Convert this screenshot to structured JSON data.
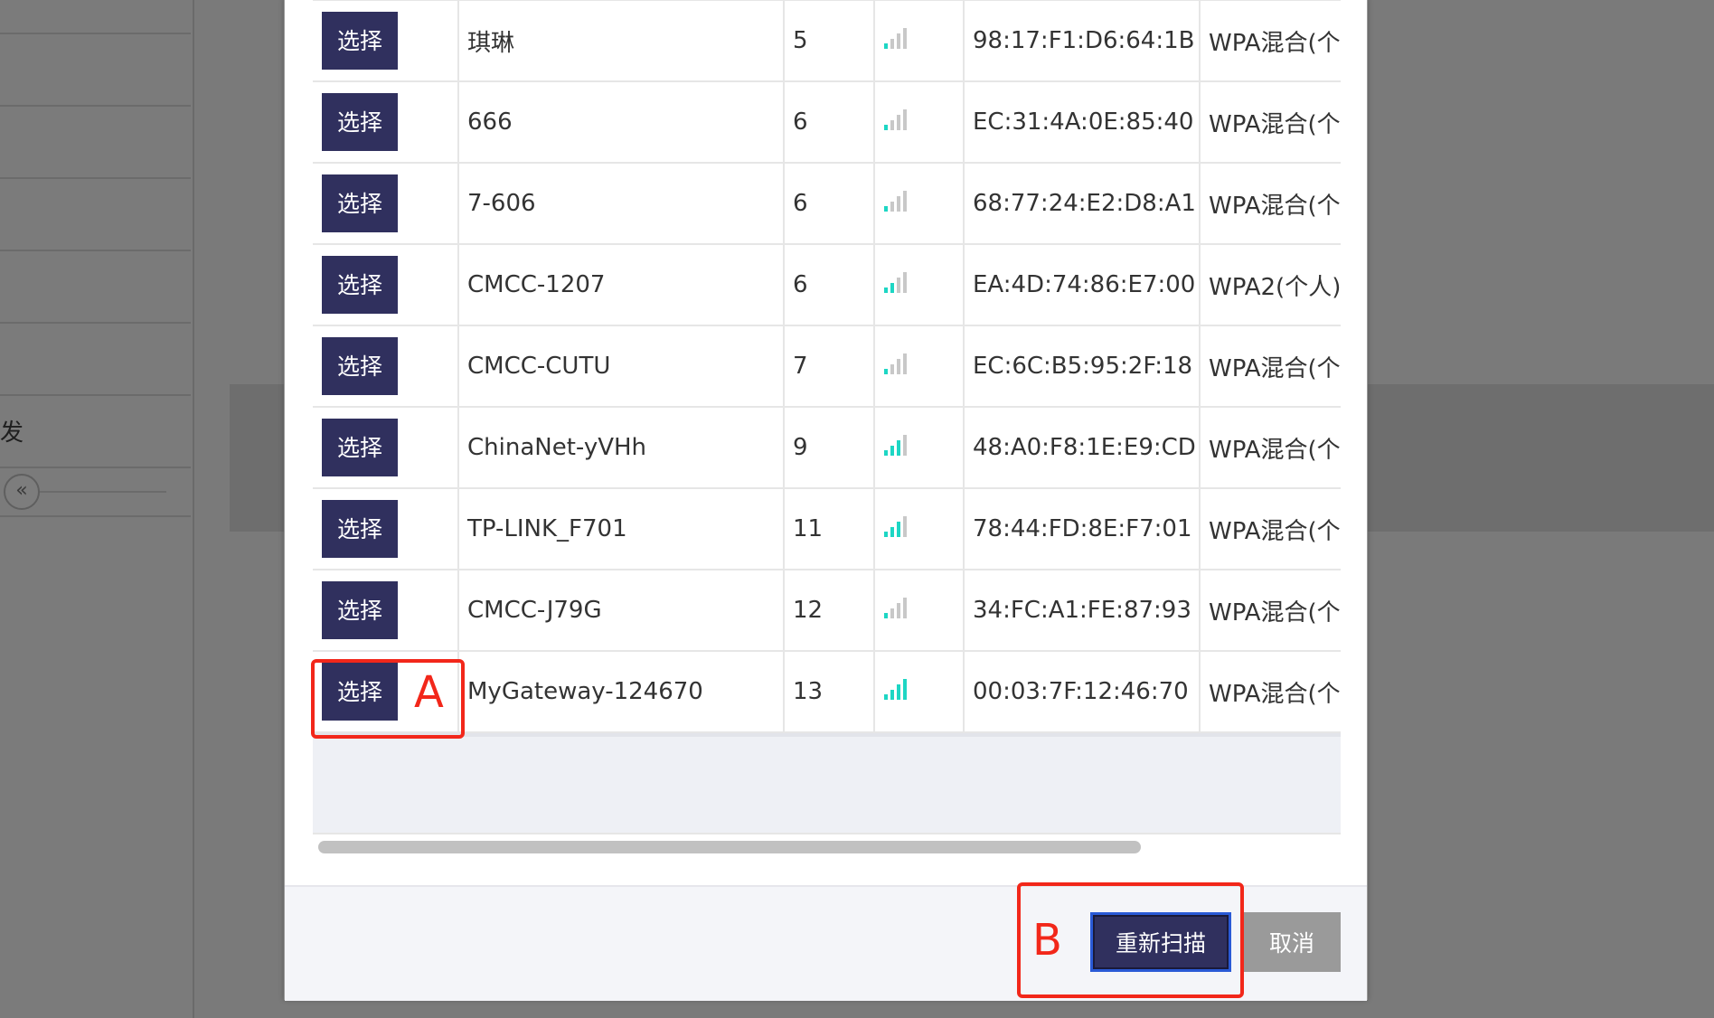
{
  "background": {
    "sidebar_text": "发",
    "collapse_icon": "«"
  },
  "wifi_table": {
    "rows": [
      {
        "button": "选择",
        "ssid": "琪琳",
        "channel": "5",
        "signal": 1,
        "mac": "98:17:F1:D6:64:1B",
        "security": "WPA混合(个人"
      },
      {
        "button": "选择",
        "ssid": "666",
        "channel": "6",
        "signal": 1,
        "mac": "EC:31:4A:0E:85:40",
        "security": "WPA混合(个人"
      },
      {
        "button": "选择",
        "ssid": "7-606",
        "channel": "6",
        "signal": 1,
        "mac": "68:77:24:E2:D8:A1",
        "security": "WPA混合(个人"
      },
      {
        "button": "选择",
        "ssid": "CMCC-1207",
        "channel": "6",
        "signal": 2,
        "mac": "EA:4D:74:86:E7:00",
        "security": "WPA2(个人)"
      },
      {
        "button": "选择",
        "ssid": "CMCC-CUTU",
        "channel": "7",
        "signal": 1,
        "mac": "EC:6C:B5:95:2F:18",
        "security": "WPA混合(个人"
      },
      {
        "button": "选择",
        "ssid": "ChinaNet-yVHh",
        "channel": "9",
        "signal": 3,
        "mac": "48:A0:F8:1E:E9:CD",
        "security": "WPA混合(个人"
      },
      {
        "button": "选择",
        "ssid": "TP-LINK_F701",
        "channel": "11",
        "signal": 3,
        "mac": "78:44:FD:8E:F7:01",
        "security": "WPA混合(个人"
      },
      {
        "button": "选择",
        "ssid": "CMCC-J79G",
        "channel": "12",
        "signal": 1,
        "mac": "34:FC:A1:FE:87:93",
        "security": "WPA混合(个人"
      },
      {
        "button": "选择",
        "ssid": "MyGateway-124670",
        "channel": "13",
        "signal": 4,
        "mac": "00:03:7F:12:46:70",
        "security": "WPA混合(个人"
      }
    ]
  },
  "footer": {
    "rescan_label": "重新扫描",
    "cancel_label": "取消"
  },
  "annotations": {
    "a_label": "A",
    "b_label": "B",
    "color": "#f2271a"
  },
  "colors": {
    "button_bg": "#30305e",
    "signal_active": "#1dd6c4",
    "signal_inactive": "#c8c8c8"
  }
}
